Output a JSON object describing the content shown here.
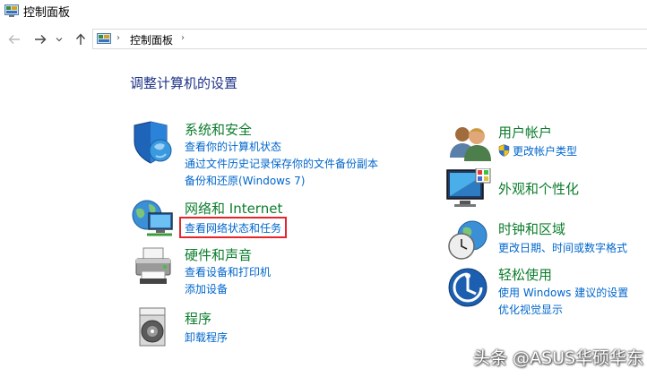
{
  "window": {
    "title": "控制面板"
  },
  "address": {
    "crumb": "控制面板",
    "separator": "›"
  },
  "heading": "调整计算机的设置",
  "left_categories": [
    {
      "title": "系统和安全",
      "links": [
        "查看你的计算机状态",
        "通过文件历史记录保存你的文件备份副本",
        "备份和还原(Windows 7)"
      ]
    },
    {
      "title": "网络和 Internet",
      "links": [
        "查看网络状态和任务"
      ]
    },
    {
      "title": "硬件和声音",
      "links": [
        "查看设备和打印机",
        "添加设备"
      ]
    },
    {
      "title": "程序",
      "links": [
        "卸载程序"
      ]
    }
  ],
  "right_categories": [
    {
      "title": "用户帐户",
      "links": [
        "更改帐户类型"
      ]
    },
    {
      "title": "外观和个性化",
      "links": []
    },
    {
      "title": "时钟和区域",
      "links": [
        "更改日期、时间或数字格式"
      ]
    },
    {
      "title": "轻松使用",
      "links": [
        "使用 Windows 建议的设置",
        "优化视觉显示"
      ]
    }
  ],
  "watermark": "头条 @ASUS华硕华东",
  "colors": {
    "category_title": "#0c7d2c",
    "link": "#0066cc",
    "heading": "#1e3287",
    "highlight": "#e4262b"
  }
}
